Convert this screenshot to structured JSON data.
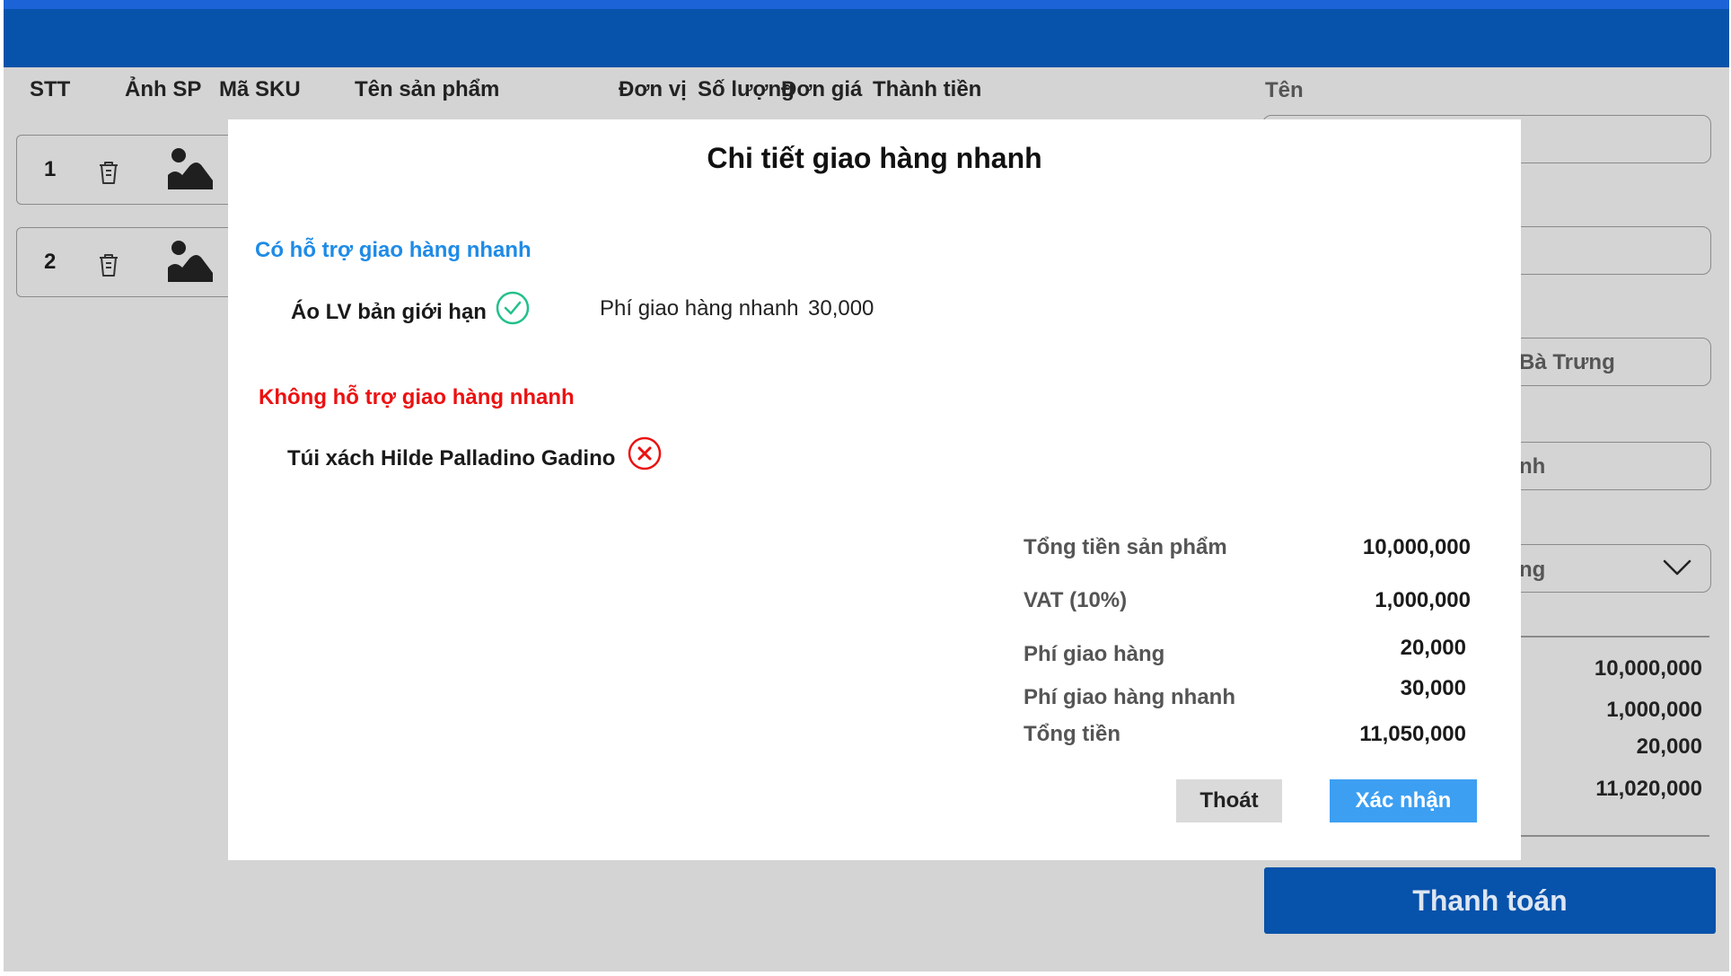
{
  "table_headers": [
    "STT",
    "Ảnh SP",
    "Mã SKU",
    "Tên sản phẩm",
    "Đơn vị",
    "Số lượng",
    "Đơn giá",
    "Thành tiền"
  ],
  "rows": [
    {
      "stt": "1"
    },
    {
      "stt": "2"
    }
  ],
  "right_panel": {
    "name_label": "Tên",
    "field_texts": [
      "Bà Trưng",
      "nh",
      "ng"
    ],
    "summary_values": [
      "10,000,000",
      "1,000,000",
      "20,000",
      "11,020,000"
    ],
    "pay_label": "Thanh toán"
  },
  "modal": {
    "title": "Chi tiết giao hàng nhanh",
    "supported_title": "Có hỗ trợ giao hàng nhanh",
    "supported_item": "Áo LV bản giới hạn",
    "express_fee_label": "Phí giao hàng nhanh",
    "express_fee_value": "30,000",
    "unsupported_title": "Không hỗ trợ giao hàng nhanh",
    "unsupported_item": "Túi xách Hilde Palladino Gadino",
    "summary": [
      {
        "label": "Tổng tiền sản phẩm",
        "value": "10,000,000"
      },
      {
        "label": "VAT (10%)",
        "value": "1,000,000"
      },
      {
        "label": "Phí giao hàng",
        "value": "20,000"
      },
      {
        "label": "Phí giao hàng nhanh",
        "value": "30,000"
      },
      {
        "label": "Tổng tiền",
        "value": "11,050,000"
      }
    ],
    "exit_label": "Thoát",
    "confirm_label": "Xác nhận"
  },
  "colors": {
    "header_blue": "#0752aa",
    "accent_blue": "#1d63d8",
    "supported_blue": "#1e8be6",
    "unsupported_red": "#ec1111",
    "check_green": "#22c08a",
    "confirm_blue": "#3d9ff2"
  },
  "icons": [
    "trash-icon",
    "image-placeholder-icon",
    "check-circle-icon",
    "x-circle-icon",
    "chevron-down-icon"
  ]
}
